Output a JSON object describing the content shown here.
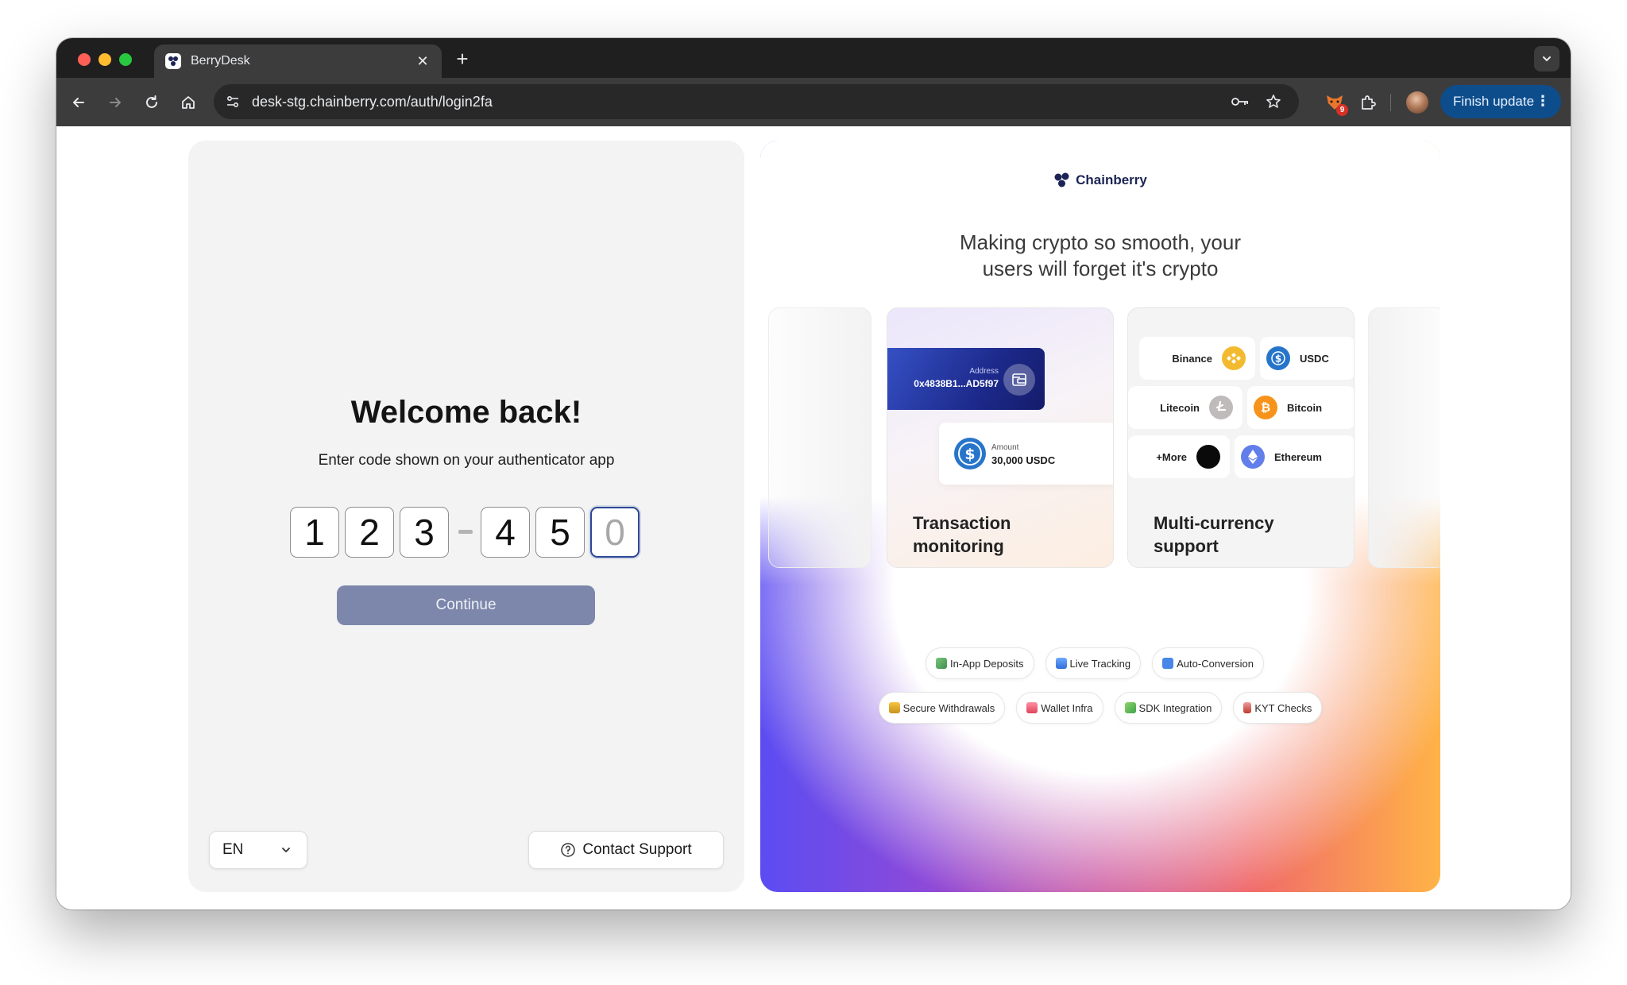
{
  "browser": {
    "tab_title": "BerryDesk",
    "tab_close": "✕",
    "new_tab": "+",
    "url": "desk-stg.chainberry.com/auth/login2fa",
    "extension_badge": "9",
    "finish_update": "Finish update",
    "menu_dots": "⋮"
  },
  "auth": {
    "title": "Welcome back!",
    "subtitle": "Enter code shown on your authenticator app",
    "code_digits": [
      "1",
      "2",
      "3",
      "4",
      "5",
      "0"
    ],
    "continue_label": "Continue",
    "language": "EN",
    "contact_support": "Contact Support"
  },
  "promo": {
    "brand": "Chainberry",
    "headline_line1": "Making crypto so smooth,  your",
    "headline_line2": "users will forget it's crypto",
    "tx_card": {
      "address_label": "Address",
      "address_value": "0x4838B1...AD5f97",
      "amount_label": "Amount",
      "amount_value": "30,000 USDC",
      "title_line1": "Transaction",
      "title_line2": "monitoring"
    },
    "mc_card": {
      "coins": {
        "binance": "Binance",
        "usdc": "USDC",
        "litecoin": "Litecoin",
        "bitcoin": "Bitcoin",
        "more": "+More",
        "ethereum": "Ethereum"
      },
      "title_line1": "Multi-currency",
      "title_line2": "support"
    },
    "features_row1": [
      "In-App Deposits",
      "Live Tracking",
      "Auto-Conversion"
    ],
    "features_row2": [
      "Secure Withdrawals",
      "Wallet Infra",
      "SDK Integration",
      "KYT Checks"
    ]
  },
  "colors": {
    "accent": "#2b4797",
    "continue_bg": "#7d87ab",
    "finish_update_bg": "#0e4d8c",
    "brand_navy": "#1b2454"
  }
}
